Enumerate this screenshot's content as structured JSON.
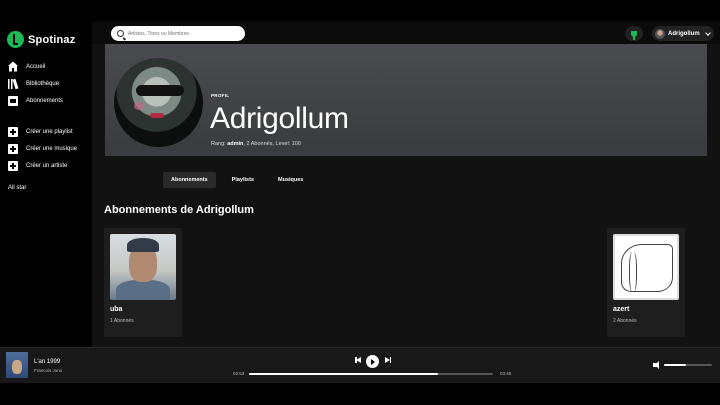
{
  "app": {
    "name": "Spotinaz",
    "accent": "#1db954"
  },
  "sidebar": {
    "items": [
      {
        "label": "Accueil",
        "icon": "home-icon"
      },
      {
        "label": "Bibliothèque",
        "icon": "library-icon"
      },
      {
        "label": "Abonnements",
        "icon": "subscriptions-icon"
      }
    ],
    "create_items": [
      {
        "label": "Créer une playlist",
        "icon": "add-playlist-icon"
      },
      {
        "label": "Créer une musique",
        "icon": "add-music-icon"
      },
      {
        "label": "Créer un artiste",
        "icon": "add-artist-icon"
      }
    ],
    "footer_item": "All star"
  },
  "topbar": {
    "search_placeholder": "Artistes, Titres ou Membres",
    "user_name": "Adrigollum"
  },
  "profile": {
    "kicker": "PROFIL",
    "name": "Adrigollum",
    "meta_rang_label": "Rang:",
    "meta_rang_value": "admin",
    "meta_rest": ", 2 Abonnés, Level: 100"
  },
  "tabs": [
    {
      "label": "Abonnements",
      "active": true
    },
    {
      "label": "Playlists",
      "active": false
    },
    {
      "label": "Musiques",
      "active": false
    }
  ],
  "section": {
    "title": "Abonnements de Adrigollum"
  },
  "subscriptions": [
    {
      "name": "uba",
      "subscribers": "1 Abonnés"
    },
    {
      "name": "azert",
      "subscribers": "2 Abonnés"
    }
  ],
  "player": {
    "title": "L'an 1999",
    "artist": "Francois Juno",
    "current_time": "02:53",
    "total_time": "03:40",
    "progress": 0.775,
    "volume": 0.45
  }
}
